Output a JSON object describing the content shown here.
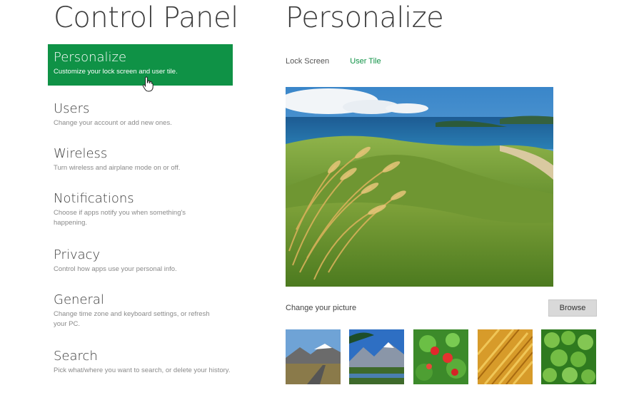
{
  "app": {
    "title": "Control Panel"
  },
  "nav": {
    "items": [
      {
        "label": "Personalize",
        "description": "Customize your lock screen and user tile.",
        "selected": true
      },
      {
        "label": "Users",
        "description": "Change your account or add new ones."
      },
      {
        "label": "Wireless",
        "description": "Turn wireless and airplane mode on or off."
      },
      {
        "label": "Notifications",
        "description": "Choose if apps notify you when something's happening."
      },
      {
        "label": "Privacy",
        "description": "Control how apps use your personal info."
      },
      {
        "label": "General",
        "description": "Change time zone and keyboard settings, or refresh your PC."
      },
      {
        "label": "Search",
        "description": "Pick what/where you want to search, or delete your history."
      }
    ]
  },
  "page": {
    "title": "Personalize",
    "tabs": [
      {
        "label": "Lock Screen",
        "active": false
      },
      {
        "label": "User Tile",
        "active": true
      }
    ],
    "change_picture_label": "Change your picture",
    "browse_label": "Browse"
  },
  "colors": {
    "accent": "#0f9246",
    "browse_bg": "#d9d9d9"
  },
  "icons": {
    "cursor": "hand-pointer-icon"
  }
}
